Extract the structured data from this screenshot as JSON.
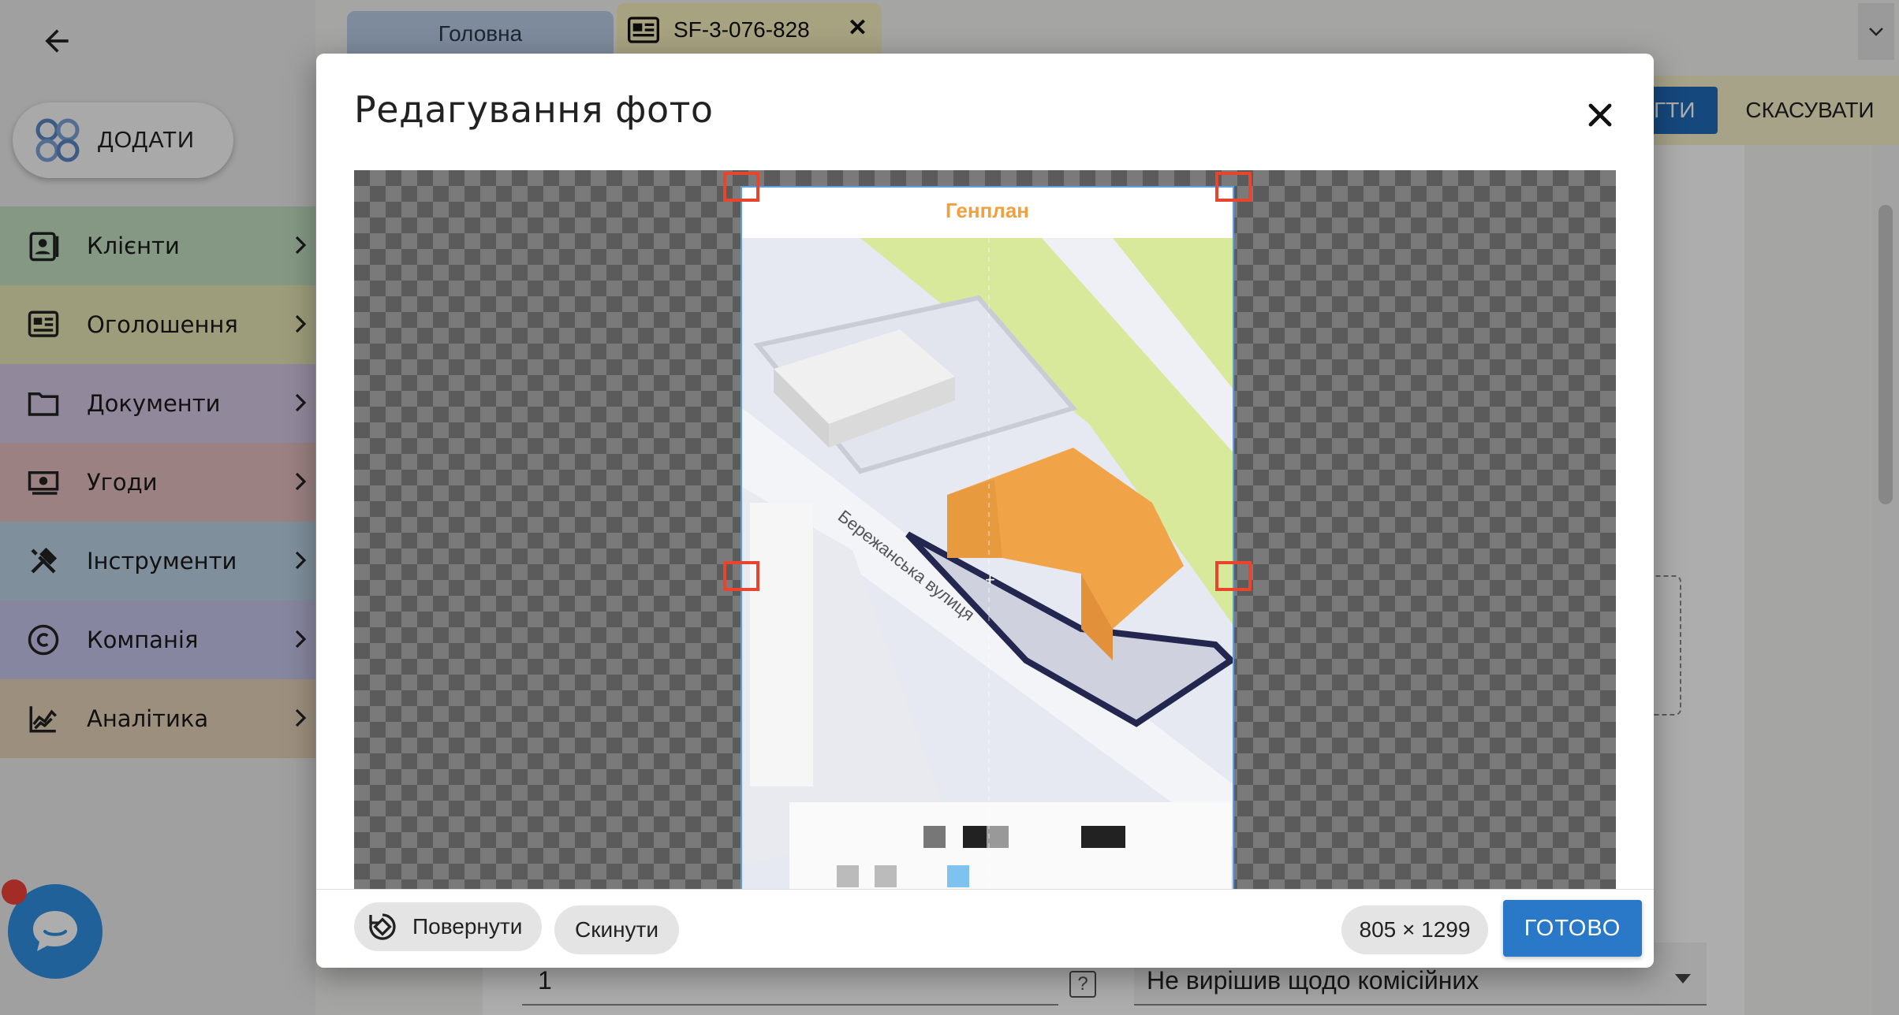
{
  "app": {
    "add_label": "ДОДАТИ",
    "menu": [
      {
        "label": "Клієнти",
        "color": "#c3e0c3",
        "icon": "contacts-icon"
      },
      {
        "label": "Оголошення",
        "color": "#e8e7b6",
        "icon": "listing-icon"
      },
      {
        "label": "Документи",
        "color": "#d7c9e6",
        "icon": "folder-icon"
      },
      {
        "label": "Угоди",
        "color": "#e5bfbf",
        "icon": "money-icon"
      },
      {
        "label": "Інструменти",
        "color": "#bcd3e6",
        "icon": "tools-icon"
      },
      {
        "label": "Компанія",
        "color": "#c8c6ec",
        "icon": "copyright-icon"
      },
      {
        "label": "Аналітика",
        "color": "#e8d3b8",
        "icon": "analytics-icon"
      }
    ]
  },
  "tabs": {
    "home_label": "Головна",
    "active_label": "SF-3-076-828",
    "close_symbol": "✕"
  },
  "toolbar": {
    "save_label": "ЕГТИ",
    "cancel_label": "СКАСУВАТИ"
  },
  "form": {
    "field_value": "1",
    "help_symbol": "?",
    "commission_value": "Не вирішив щодо комісійних"
  },
  "modal": {
    "title": "Редагування фото",
    "photo_title": "Генплан",
    "street_label": "Бережанська вулиця",
    "rotate_label": "Повернути",
    "reset_label": "Скинути",
    "dimensions": "805 × 1299",
    "done_label": "ГОТОВО"
  }
}
